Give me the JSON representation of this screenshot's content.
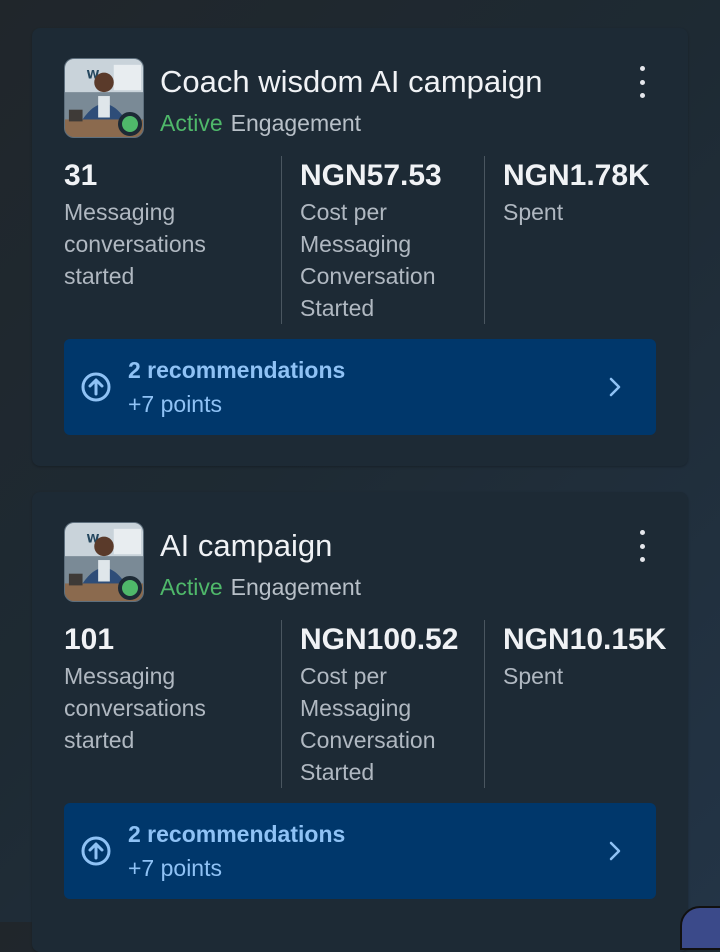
{
  "campaigns": [
    {
      "name": "Coach wisdom AI campaign",
      "status": "Active",
      "objective": "Engagement",
      "metrics": [
        {
          "value": "31",
          "label": "Messaging conversations started"
        },
        {
          "value": "NGN57.53",
          "label": "Cost per Messaging Conversation Started"
        },
        {
          "value": "NGN1.78K",
          "label": "Spent"
        }
      ],
      "recommendation": {
        "title": "2 recommendations",
        "points": "+7 points"
      }
    },
    {
      "name": "AI campaign",
      "status": "Active",
      "objective": "Engagement",
      "metrics": [
        {
          "value": "101",
          "label": "Messaging conversations started"
        },
        {
          "value": "NGN100.52",
          "label": "Cost per Messaging Conversation Started"
        },
        {
          "value": "NGN10.15K",
          "label": "Spent"
        }
      ],
      "recommendation": {
        "title": "2 recommendations",
        "points": "+7 points"
      }
    }
  ],
  "icons": {
    "avatar": "campaign-thumbnail-icon",
    "status": "active-status-dot-icon",
    "more": "more-vertical-icon",
    "recommendation": "arrow-up-circle-icon",
    "chevron": "chevron-right-icon"
  },
  "colors": {
    "active": "#4fb86a",
    "card_bg": "#1d2a35",
    "reco_bg": "#00376b",
    "reco_text": "#8fc2f5"
  }
}
